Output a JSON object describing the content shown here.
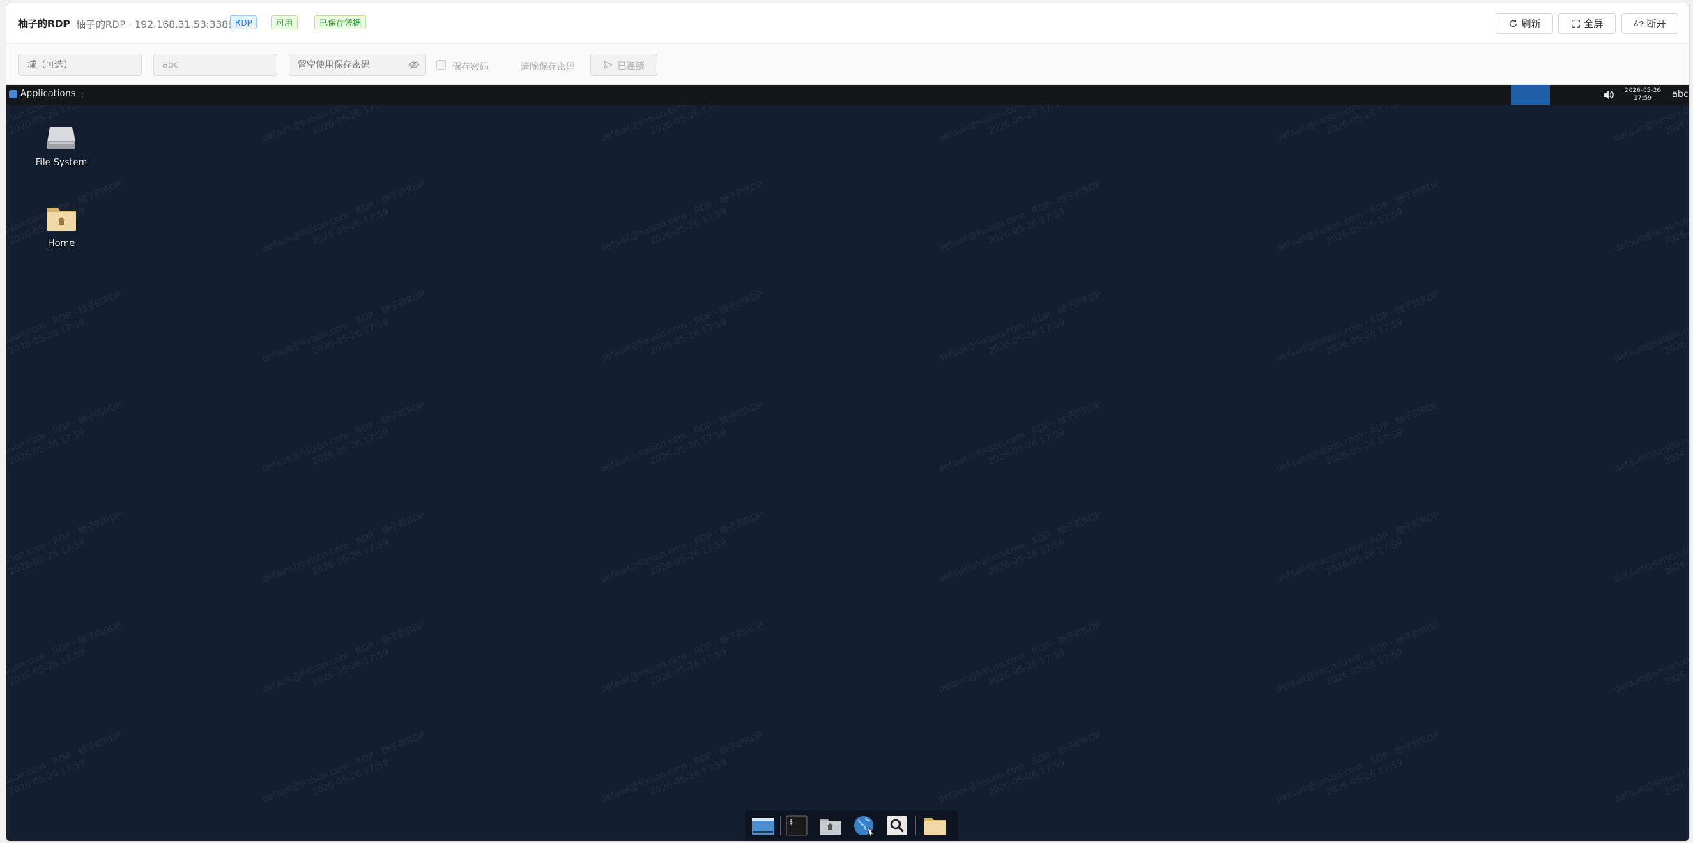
{
  "header": {
    "title": "柚子的RDP",
    "subtitle": "柚子的RDP · 192.168.31.53:3389",
    "tags": {
      "protocol": "RDP",
      "status": "可用",
      "credentials": "已保存凭据"
    },
    "buttons": {
      "refresh": "刷新",
      "fullscreen": "全屏",
      "disconnect": "断开"
    }
  },
  "toolbar": {
    "domain_placeholder": "域（可选）",
    "username_value": "abc",
    "password_placeholder": "留空使用保存密码",
    "save_password_label": "保存密码",
    "save_password_checked": false,
    "clear_saved_label": "清除保存密码",
    "connect_label": "已连接"
  },
  "desktop": {
    "panel": {
      "applications_label": "Applications",
      "clock_date": "2026-05-26",
      "clock_time": "17:59",
      "keyboard_layout": "abc"
    },
    "icons": [
      {
        "label": "File System",
        "icon": "drive-icon"
      },
      {
        "label": "Home",
        "icon": "home-folder-icon"
      }
    ],
    "watermark": {
      "line1": "default@liaison.com · RDP · 柚子的RDP",
      "line2": "2026-05-26 17:59"
    },
    "dock": [
      {
        "name": "show-desktop",
        "icon": "show-desktop-icon"
      },
      {
        "name": "terminal",
        "icon": "terminal-icon"
      },
      {
        "name": "file-manager",
        "icon": "home-folder-icon"
      },
      {
        "name": "web-browser",
        "icon": "globe-icon"
      },
      {
        "name": "app-finder",
        "icon": "search-icon"
      },
      {
        "name": "folder",
        "icon": "folder-icon"
      }
    ]
  },
  "colors": {
    "desktop_bg": "#131f30",
    "panel_bg": "#14161a",
    "workspace_active": "#1f5fa8",
    "tag_blue": "#2a7ad6",
    "tag_green": "#2f9b2f"
  }
}
